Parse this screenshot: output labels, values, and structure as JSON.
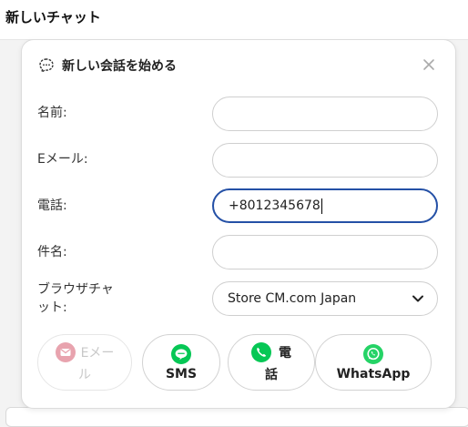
{
  "page": {
    "title": "新しいチャット"
  },
  "dialog": {
    "title": "新しい会話を始める",
    "fields": {
      "name_label": "名前:",
      "name_value": "",
      "email_label": "Eメール:",
      "email_value": "",
      "phone_label": "電話:",
      "phone_value": "+8012345678",
      "subject_label": "件名:",
      "subject_value": "",
      "browser_label_line1": "ブラウザチャ",
      "browser_label_line2": "ット:",
      "browser_selected": "Store CM.com Japan"
    },
    "channels": [
      {
        "line1": "Eメー",
        "line2": "ル"
      },
      {
        "label": "SMS"
      },
      {
        "line1": "電",
        "line2": "話"
      },
      {
        "label": "WhatsApp"
      }
    ]
  },
  "colors": {
    "focus_border": "#2450a6",
    "line_green": "#06c755",
    "whatsapp_green": "#25d366",
    "email_disabled": "#e8a3ae"
  }
}
